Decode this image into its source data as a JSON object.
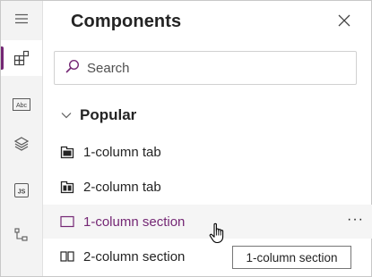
{
  "rail": {
    "items": [
      {
        "name": "menu-icon"
      },
      {
        "name": "components-icon",
        "active": true
      },
      {
        "name": "text-field-icon",
        "text": "Abc"
      },
      {
        "name": "layers-icon"
      },
      {
        "name": "javascript-icon",
        "text": "JS"
      },
      {
        "name": "tree-view-icon"
      }
    ]
  },
  "panel": {
    "title": "Components",
    "close_icon": "close-icon"
  },
  "search": {
    "placeholder": "Search",
    "value": ""
  },
  "group": {
    "label": "Popular",
    "expanded": true
  },
  "items": [
    {
      "label": "1-column tab",
      "icon": "tab-1-column-icon"
    },
    {
      "label": "2-column tab",
      "icon": "tab-2-column-icon"
    },
    {
      "label": "1-column section",
      "icon": "section-1-column-icon",
      "hover": true,
      "more": "···"
    },
    {
      "label": "2-column section",
      "icon": "section-2-column-icon"
    }
  ],
  "tooltip": {
    "text": "1-column section"
  },
  "colors": {
    "accent": "#742774",
    "rail_bg": "#f3f3f3",
    "hover_bg": "#f5f5f5"
  }
}
